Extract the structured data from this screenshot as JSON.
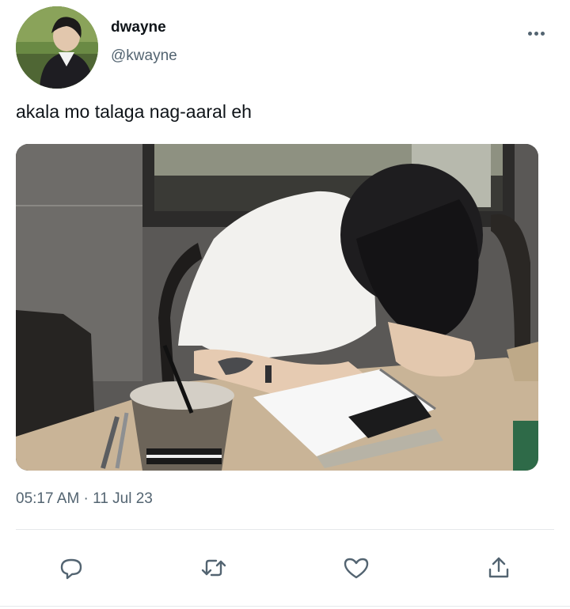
{
  "tweet": {
    "author_name": "dwayne",
    "author_handle": "@kwayne",
    "text": "akala mo talaga nag-aaral eh",
    "timestamp": "05:17 AM · 11 Jul 23"
  },
  "icons": {
    "more": "more-dots-icon",
    "reply": "reply-icon",
    "retweet": "retweet-icon",
    "like": "like-icon",
    "share": "share-icon"
  },
  "colors": {
    "text": "#0f1419",
    "muted": "#536471",
    "divider": "#e6e9eb"
  }
}
